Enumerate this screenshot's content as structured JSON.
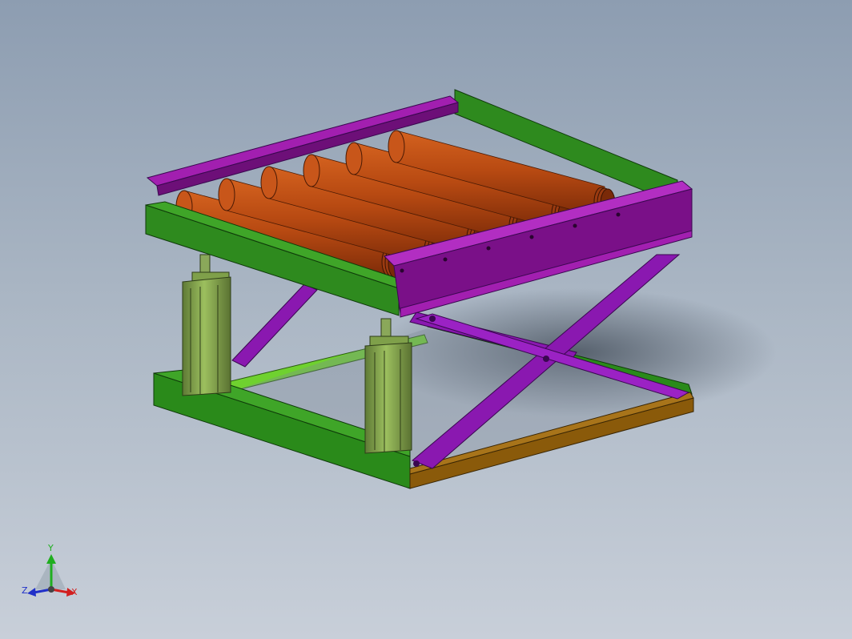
{
  "viewport": {
    "background_top": "#8d9db1",
    "background_bottom": "#c8cfd9"
  },
  "model": {
    "roller_count": 6,
    "colors": {
      "roller": "#b84a12",
      "roller_end": "#7a2a08",
      "side_rail": "#a21fb0",
      "side_rail_dark": "#6d0f78",
      "end_plate": "#2e8a1e",
      "end_plate_dark": "#1f6a14",
      "scissor_arm": "#8a18b0",
      "base_frame": "#2a8a1a",
      "base_front": "#8a5a0a",
      "cross_bar": "#6fd12f",
      "cylinder": "#7fa04a",
      "cylinder_dark": "#5f7a36"
    }
  },
  "triad": {
    "y_label": "Y",
    "z_label": "Z",
    "x_label": "X",
    "y_color": "#1fae1f",
    "z_color": "#2030c8",
    "x_color": "#d21f1f"
  }
}
